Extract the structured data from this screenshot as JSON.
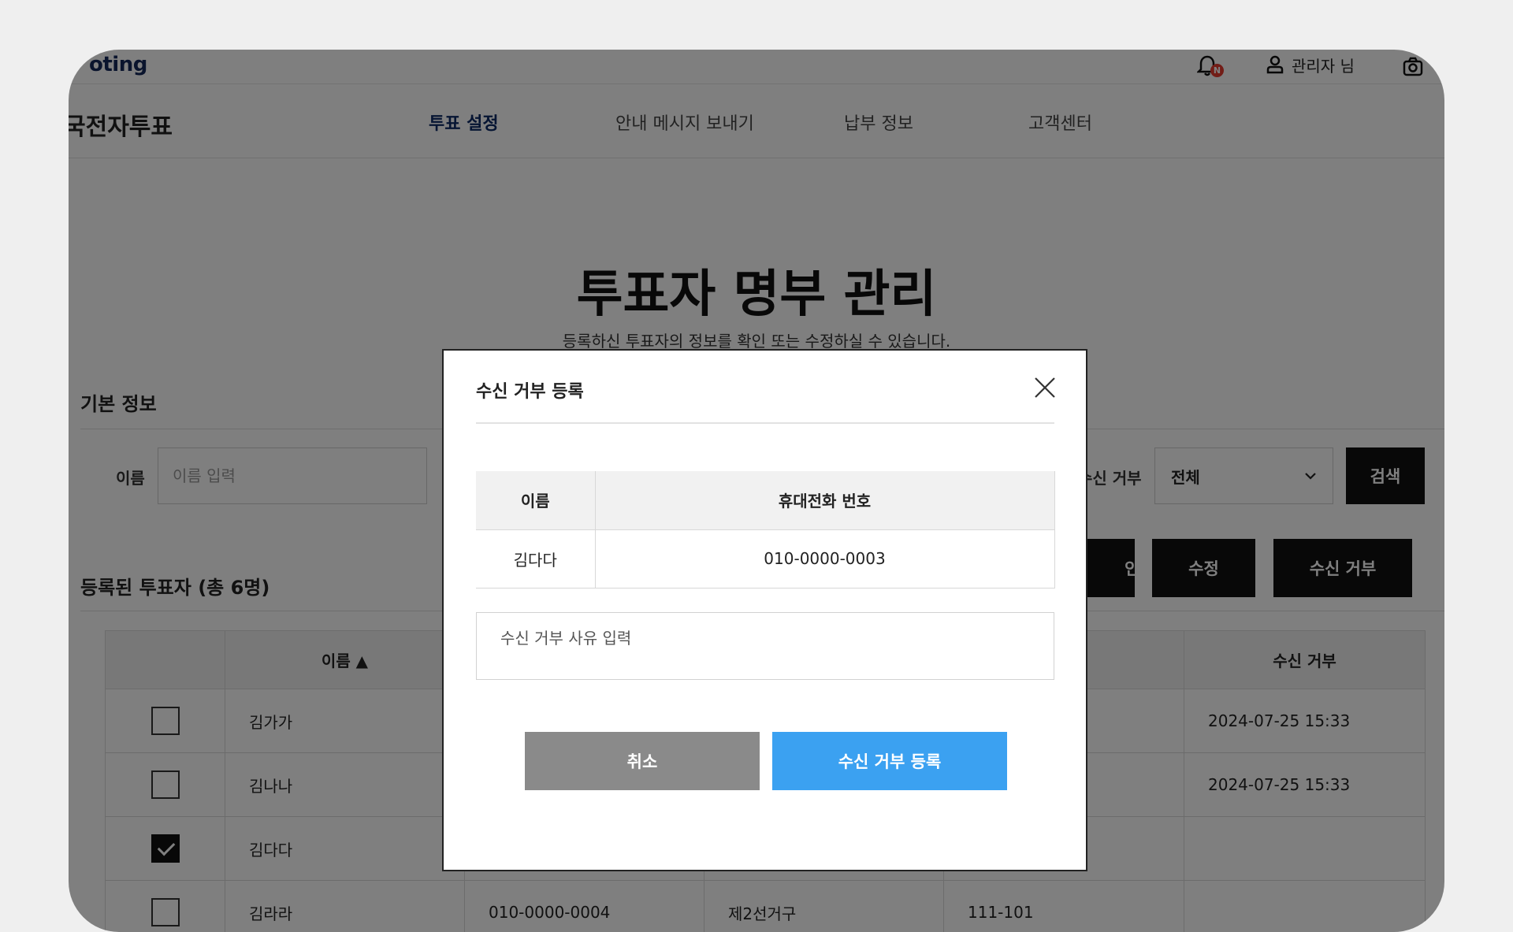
{
  "topbar": {
    "logo": "oting",
    "notification_badge": "N",
    "user_label": "관리자 님"
  },
  "nav": {
    "brand": "국전자투표",
    "items": [
      {
        "label": "투표 설정",
        "active": true
      },
      {
        "label": "안내 메시지 보내기",
        "active": false
      },
      {
        "label": "납부 정보",
        "active": false
      },
      {
        "label": "고객센터",
        "active": false
      }
    ]
  },
  "page": {
    "title": "투표자 명부 관리",
    "subtitle": "등록하신 투표자의 정보를 확인 또는 수정하실 수 있습니다."
  },
  "basic_info": {
    "title": "기본 정보",
    "name_label": "이름",
    "name_placeholder": "이름 입력",
    "reject_label": "수신 거부",
    "reject_select_value": "전체",
    "search_button": "검색"
  },
  "registered": {
    "title": "등록된 투표자 (총 6명)",
    "buttons": {
      "confirm": "인",
      "edit": "수정",
      "reject": "수신 거부"
    }
  },
  "table": {
    "headers": {
      "name": "이름 ▲",
      "reject": "수신 거부"
    },
    "rows": [
      {
        "checked": false,
        "name": "김가가",
        "phone": "",
        "group": "",
        "unit": "",
        "reject": "2024-07-25 15:33"
      },
      {
        "checked": false,
        "name": "김나나",
        "phone": "",
        "group": "",
        "unit": "",
        "reject": "2024-07-25 15:33"
      },
      {
        "checked": true,
        "name": "김다다",
        "phone": "",
        "group": "",
        "unit": "",
        "reject": ""
      },
      {
        "checked": false,
        "name": "김라라",
        "phone": "010-0000-0004",
        "group": "제2선거구",
        "unit": "111-101",
        "reject": ""
      }
    ]
  },
  "modal": {
    "title": "수신 거부 등록",
    "headers": {
      "name": "이름",
      "phone": "휴대전화 번호"
    },
    "row": {
      "name": "김다다",
      "phone": "010-0000-0003"
    },
    "reason_placeholder": "수신 거부 사유 입력",
    "cancel_button": "취소",
    "confirm_button": "수신 거부 등록"
  },
  "colors": {
    "brand": "#0d2a66",
    "confirm": "#3ba1f1",
    "cancel": "#8a8a8a",
    "badge": "#e53a2f"
  }
}
